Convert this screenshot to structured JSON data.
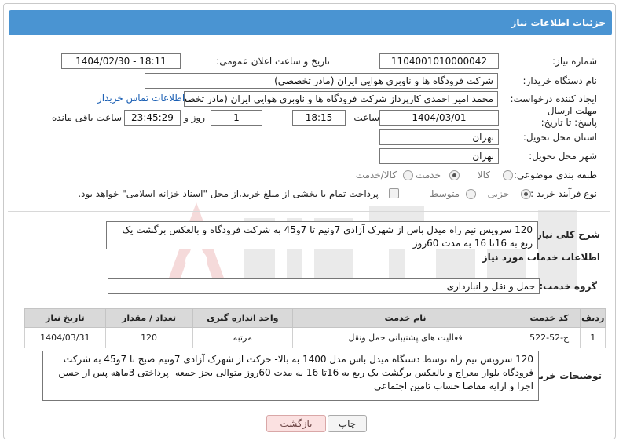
{
  "header": {
    "title": "جزئیات اطلاعات نیاز"
  },
  "form": {
    "need_number": {
      "label": "شماره نیاز:",
      "value": "1104001010000042"
    },
    "announce_datetime": {
      "label": "تاریخ و ساعت اعلان عمومی:",
      "value": "1404/02/30 - 18:11"
    },
    "buyer_org": {
      "label": "نام دستگاه خریدار:",
      "value": "شرکت فرودگاه ها و ناوبری هوایی ایران (مادر تخصصی)"
    },
    "creator": {
      "label": "ایجاد کننده درخواست:",
      "value": "محمد امیر احمدی کارپرداز شرکت فرودگاه ها و ناوبری هوایی ایران (مادر تخصصی)",
      "contact_link": "اطلاعات تماس خریدار"
    },
    "deadline": {
      "label": "مهلت ارسال پاسخ: تا تاریخ:",
      "date": "1404/03/01",
      "time_label": "ساعت",
      "time": "18:15",
      "days": "1",
      "days_label": "روز و",
      "remaining": "23:45:29",
      "remaining_label": "ساعت باقی مانده"
    },
    "delivery_province": {
      "label": "استان محل تحویل:",
      "value": "تهران"
    },
    "delivery_city": {
      "label": "شهر محل تحویل:",
      "value": "تهران"
    },
    "category": {
      "label": "طبقه بندی موضوعی:",
      "options": [
        "کالا",
        "خدمت",
        "کالا/خدمت"
      ],
      "selected": "خدمت"
    },
    "purchase_process": {
      "label": "نوع فرآیند خرید :",
      "options": [
        "جزیی",
        "متوسط"
      ],
      "selected": "جزیی",
      "note": "پرداخت تمام یا بخشی از مبلغ خرید،از محل \"اسناد خزانه اسلامی\" خواهد بود."
    }
  },
  "summary": {
    "label": "شرح کلی نیاز:",
    "text": "120 سرویس نیم راه میدل باس از شهرک آزادی 7ونیم تا 7و45 به شرکت فرودگاه و بالعکس  برگشت یک ربع به 16تا 16 به مدت 60روز"
  },
  "services": {
    "section_title": "اطلاعات خدمات مورد نیاز",
    "group_label": "گروه خدمت:",
    "group_value": "حمل و نقل و انبارداری",
    "columns": [
      "ردیف",
      "کد خدمت",
      "نام خدمت",
      "واحد اندازه گیری",
      "تعداد / مقدار",
      "تاریخ نیاز"
    ],
    "rows": [
      [
        "1",
        "ج-52-522",
        "فعالیت های پشتیبانی حمل ونقل",
        "مرتبه",
        "120",
        "1404/03/31"
      ]
    ]
  },
  "buyer_notes": {
    "label": "توضیحات خریدار:",
    "text": "120 سرویس نیم راه توسط دستگاه میدل باس مدل 1400 به بالا- حرکت از شهرک آزادی 7ونیم صبح تا 7و45 به شرکت فرودگاه  بلوار معراج و بالعکس  برگشت یک ربع به 16تا 16 به مدت 60روز متوالی بجز جمعه -پرداختی 3ماهه پس از حسن اجرا و ارایه مفاصا حساب تامین اجتماعی"
  },
  "buttons": {
    "print": "چاپ",
    "back": "بازگشت"
  },
  "colors": {
    "header_bg": "#4a94d2",
    "link": "#1a5fb4",
    "back_button_bg": "#fbe1e1"
  }
}
